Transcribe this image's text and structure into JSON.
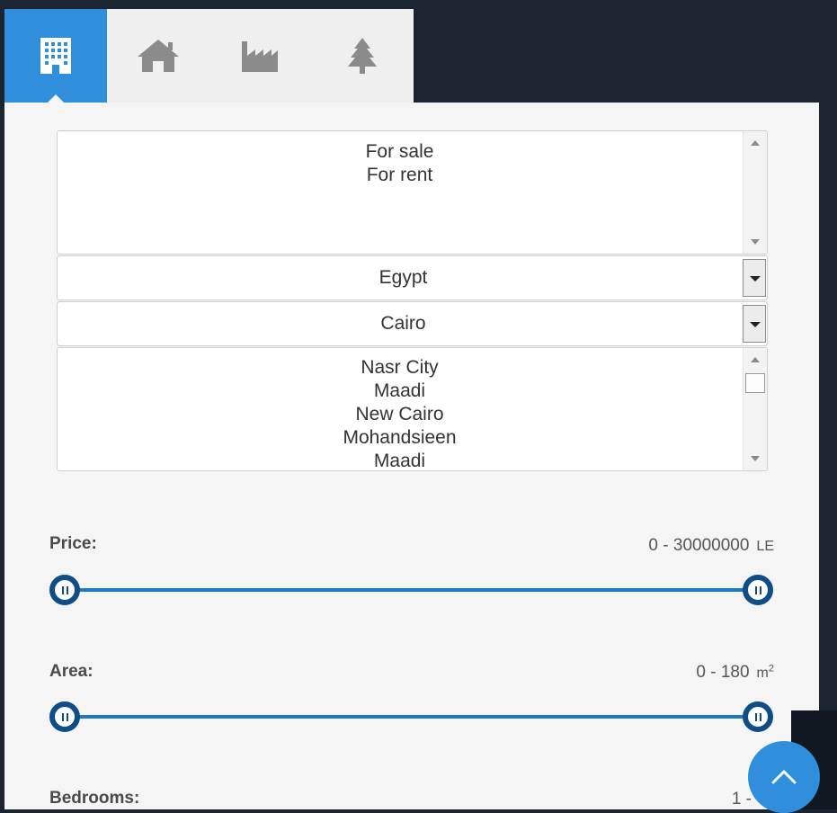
{
  "tabs": [
    {
      "name": "building-icon",
      "active": true
    },
    {
      "name": "house-icon",
      "active": false
    },
    {
      "name": "factory-icon",
      "active": false
    },
    {
      "name": "tree-icon",
      "active": false
    }
  ],
  "listing_type": {
    "options": [
      "For sale",
      "For rent"
    ]
  },
  "country": {
    "value": "Egypt"
  },
  "city": {
    "value": "Cairo"
  },
  "districts": {
    "options": [
      "Nasr City",
      "Maadi",
      "New Cairo",
      "Mohandsieen",
      "Maadi"
    ]
  },
  "price": {
    "label": "Price:",
    "range": "0 - 30000000",
    "unit": "LE",
    "min_fraction": 0,
    "max_fraction": 1
  },
  "area": {
    "label": "Area:",
    "range": "0 - 180",
    "unit": "m",
    "unit_sup": "2",
    "min_fraction": 0,
    "max_fraction": 1
  },
  "bedrooms": {
    "label": "Bedrooms:",
    "range": "1 -"
  },
  "colors": {
    "accent": "#2f8fdc",
    "slider_track": "#1f78c2",
    "slider_handle": "#0f4d86",
    "background": "#1b2431"
  }
}
